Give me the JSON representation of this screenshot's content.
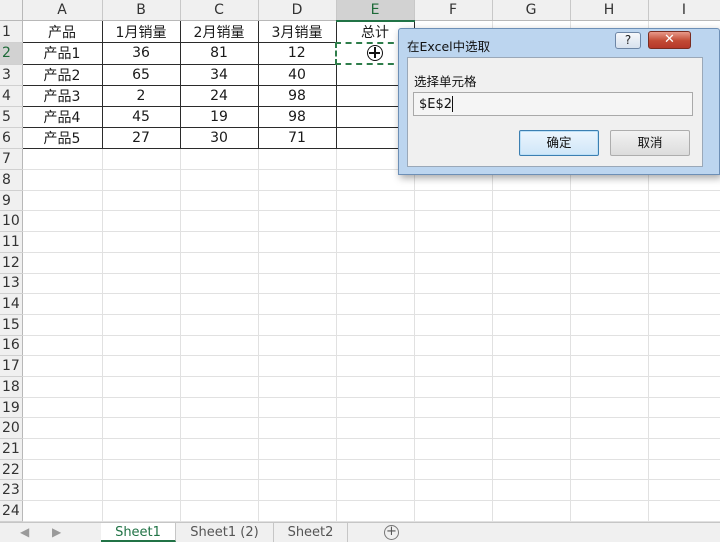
{
  "spreadsheet": {
    "columns": [
      "A",
      "B",
      "C",
      "D",
      "E",
      "F",
      "G",
      "H",
      "I"
    ],
    "active_column": "E",
    "row_count": 24,
    "active_row": 2,
    "header_row": [
      "产品",
      "1月销量",
      "2月销量",
      "3月销量",
      "总计"
    ],
    "data_rows": [
      [
        "产品1",
        "36",
        "81",
        "12"
      ],
      [
        "产品2",
        "65",
        "34",
        "40"
      ],
      [
        "产品3",
        "2",
        "24",
        "98"
      ],
      [
        "产品4",
        "45",
        "19",
        "98"
      ],
      [
        "产品5",
        "27",
        "30",
        "71"
      ]
    ]
  },
  "dialog": {
    "title": "在Excel中选取",
    "help_label": "?",
    "close_label": "✕",
    "field_label": "选择单元格",
    "field_value": "$E$2",
    "ok_label": "确定",
    "cancel_label": "取消"
  },
  "tabs": {
    "nav_prev": "◀",
    "nav_next": "▶",
    "items": [
      {
        "label": "Sheet1",
        "active": true
      },
      {
        "label": "Sheet1 (2)",
        "active": false
      },
      {
        "label": "Sheet2",
        "active": false
      }
    ],
    "add_label": "+"
  },
  "colors": {
    "accent_green": "#217346",
    "dialog_frame": "#bcd5ef",
    "close_red": "#c24a34"
  }
}
